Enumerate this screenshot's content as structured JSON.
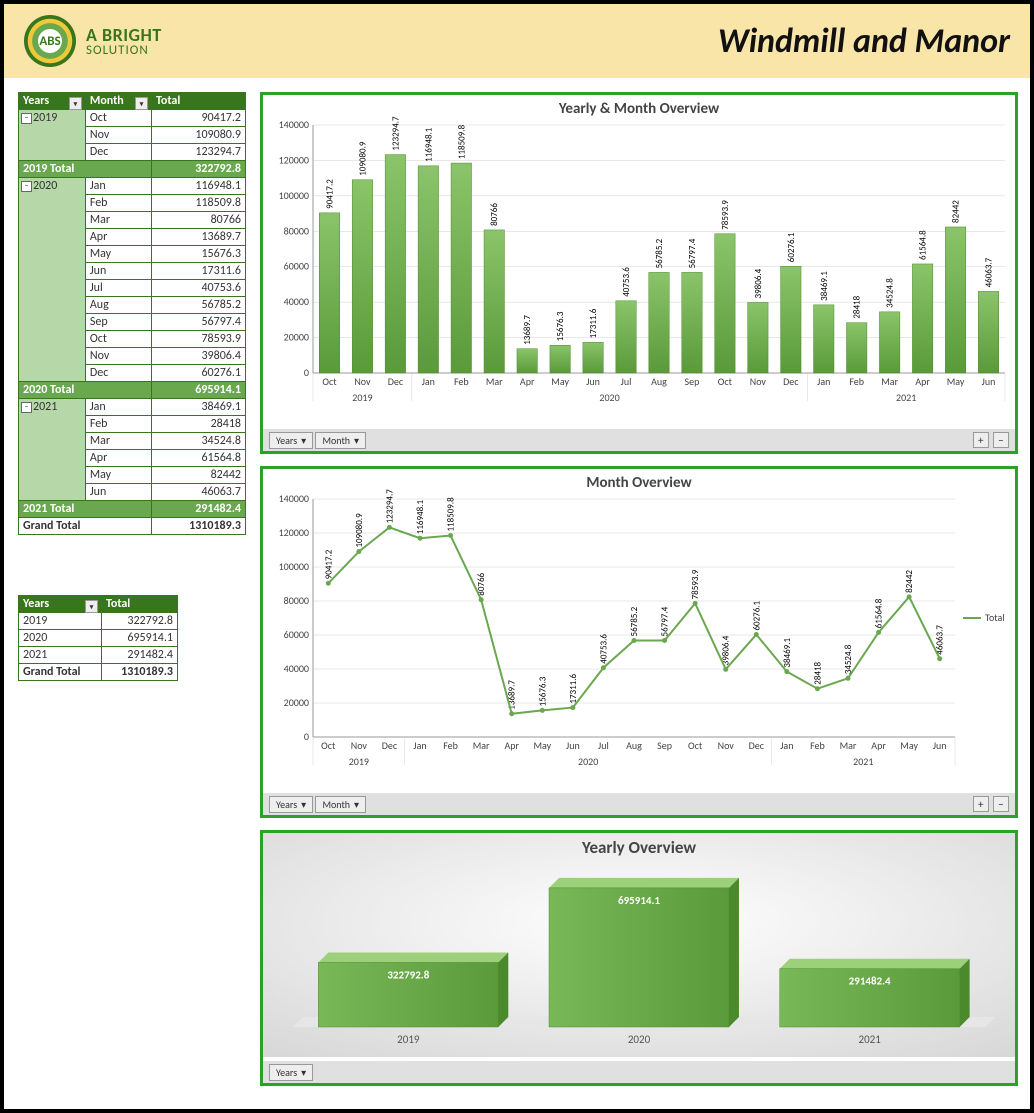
{
  "header": {
    "logo_text": "ABS",
    "brand_line1": "A BRIGHT",
    "brand_line2": "SOLUTION",
    "title": "Windmill and Manor"
  },
  "pivot": {
    "cols": [
      "Years",
      "Month",
      "Total"
    ],
    "groups": [
      {
        "year": "2019",
        "rows": [
          {
            "m": "Oct",
            "v": "90417.2"
          },
          {
            "m": "Nov",
            "v": "109080.9"
          },
          {
            "m": "Dec",
            "v": "123294.7"
          }
        ],
        "sub_label": "2019 Total",
        "sub_v": "322792.8"
      },
      {
        "year": "2020",
        "rows": [
          {
            "m": "Jan",
            "v": "116948.1"
          },
          {
            "m": "Feb",
            "v": "118509.8"
          },
          {
            "m": "Mar",
            "v": "80766"
          },
          {
            "m": "Apr",
            "v": "13689.7"
          },
          {
            "m": "May",
            "v": "15676.3"
          },
          {
            "m": "Jun",
            "v": "17311.6"
          },
          {
            "m": "Jul",
            "v": "40753.6"
          },
          {
            "m": "Aug",
            "v": "56785.2"
          },
          {
            "m": "Sep",
            "v": "56797.4"
          },
          {
            "m": "Oct",
            "v": "78593.9"
          },
          {
            "m": "Nov",
            "v": "39806.4"
          },
          {
            "m": "Dec",
            "v": "60276.1"
          }
        ],
        "sub_label": "2020 Total",
        "sub_v": "695914.1"
      },
      {
        "year": "2021",
        "rows": [
          {
            "m": "Jan",
            "v": "38469.1"
          },
          {
            "m": "Feb",
            "v": "28418"
          },
          {
            "m": "Mar",
            "v": "34524.8"
          },
          {
            "m": "Apr",
            "v": "61564.8"
          },
          {
            "m": "May",
            "v": "82442"
          },
          {
            "m": "Jun",
            "v": "46063.7"
          }
        ],
        "sub_label": "2021 Total",
        "sub_v": "291482.4"
      }
    ],
    "grand_label": "Grand Total",
    "grand_v": "1310189.3"
  },
  "summary": {
    "cols": [
      "Years",
      "Total"
    ],
    "rows": [
      {
        "y": "2019",
        "v": "322792.8"
      },
      {
        "y": "2020",
        "v": "695914.1"
      },
      {
        "y": "2021",
        "v": "291482.4"
      }
    ],
    "grand_label": "Grand Total",
    "grand_v": "1310189.3"
  },
  "chart_data": [
    {
      "id": "bar_month",
      "type": "bar",
      "title": "Yearly & Month Overview",
      "ylim": [
        0,
        140000
      ],
      "ystep": 20000,
      "categories": [
        "Oct",
        "Nov",
        "Dec",
        "Jan",
        "Feb",
        "Mar",
        "Apr",
        "May",
        "Jun",
        "Jul",
        "Aug",
        "Sep",
        "Oct",
        "Nov",
        "Dec",
        "Jan",
        "Feb",
        "Mar",
        "Apr",
        "May",
        "Jun"
      ],
      "groups": [
        {
          "label": "2019",
          "span": [
            0,
            2
          ]
        },
        {
          "label": "2020",
          "span": [
            3,
            14
          ]
        },
        {
          "label": "2021",
          "span": [
            15,
            20
          ]
        }
      ],
      "values": [
        90417.2,
        109080.9,
        123294.7,
        116948.1,
        118509.8,
        80766,
        13689.7,
        15676.3,
        17311.6,
        40753.6,
        56785.2,
        56797.4,
        78593.9,
        39806.4,
        60276.1,
        38469.1,
        28418,
        34524.8,
        61564.8,
        82442,
        46063.7
      ]
    },
    {
      "id": "line_month",
      "type": "line",
      "title": "Month Overview",
      "ylim": [
        0,
        140000
      ],
      "ystep": 20000,
      "series_name": "Total",
      "categories": [
        "Oct",
        "Nov",
        "Dec",
        "Jan",
        "Feb",
        "Mar",
        "Apr",
        "May",
        "Jun",
        "Jul",
        "Aug",
        "Sep",
        "Oct",
        "Nov",
        "Dec",
        "Jan",
        "Feb",
        "Mar",
        "Apr",
        "May",
        "Jun"
      ],
      "groups": [
        {
          "label": "2019",
          "span": [
            0,
            2
          ]
        },
        {
          "label": "2020",
          "span": [
            3,
            14
          ]
        },
        {
          "label": "2021",
          "span": [
            15,
            20
          ]
        }
      ],
      "values": [
        90417.2,
        109080.9,
        123294.7,
        116948.1,
        118509.8,
        80766,
        13689.7,
        15676.3,
        17311.6,
        40753.6,
        56785.2,
        56797.4,
        78593.9,
        39806.4,
        60276.1,
        38469.1,
        28418,
        34524.8,
        61564.8,
        82442,
        46063.7
      ]
    },
    {
      "id": "bar_year",
      "type": "bar",
      "title": "Yearly Overview",
      "categories": [
        "2019",
        "2020",
        "2021"
      ],
      "values": [
        322792.8,
        695914.1,
        291482.4
      ]
    }
  ],
  "filters": {
    "years": "Years",
    "month": "Month",
    "plus": "+",
    "minus": "−"
  }
}
